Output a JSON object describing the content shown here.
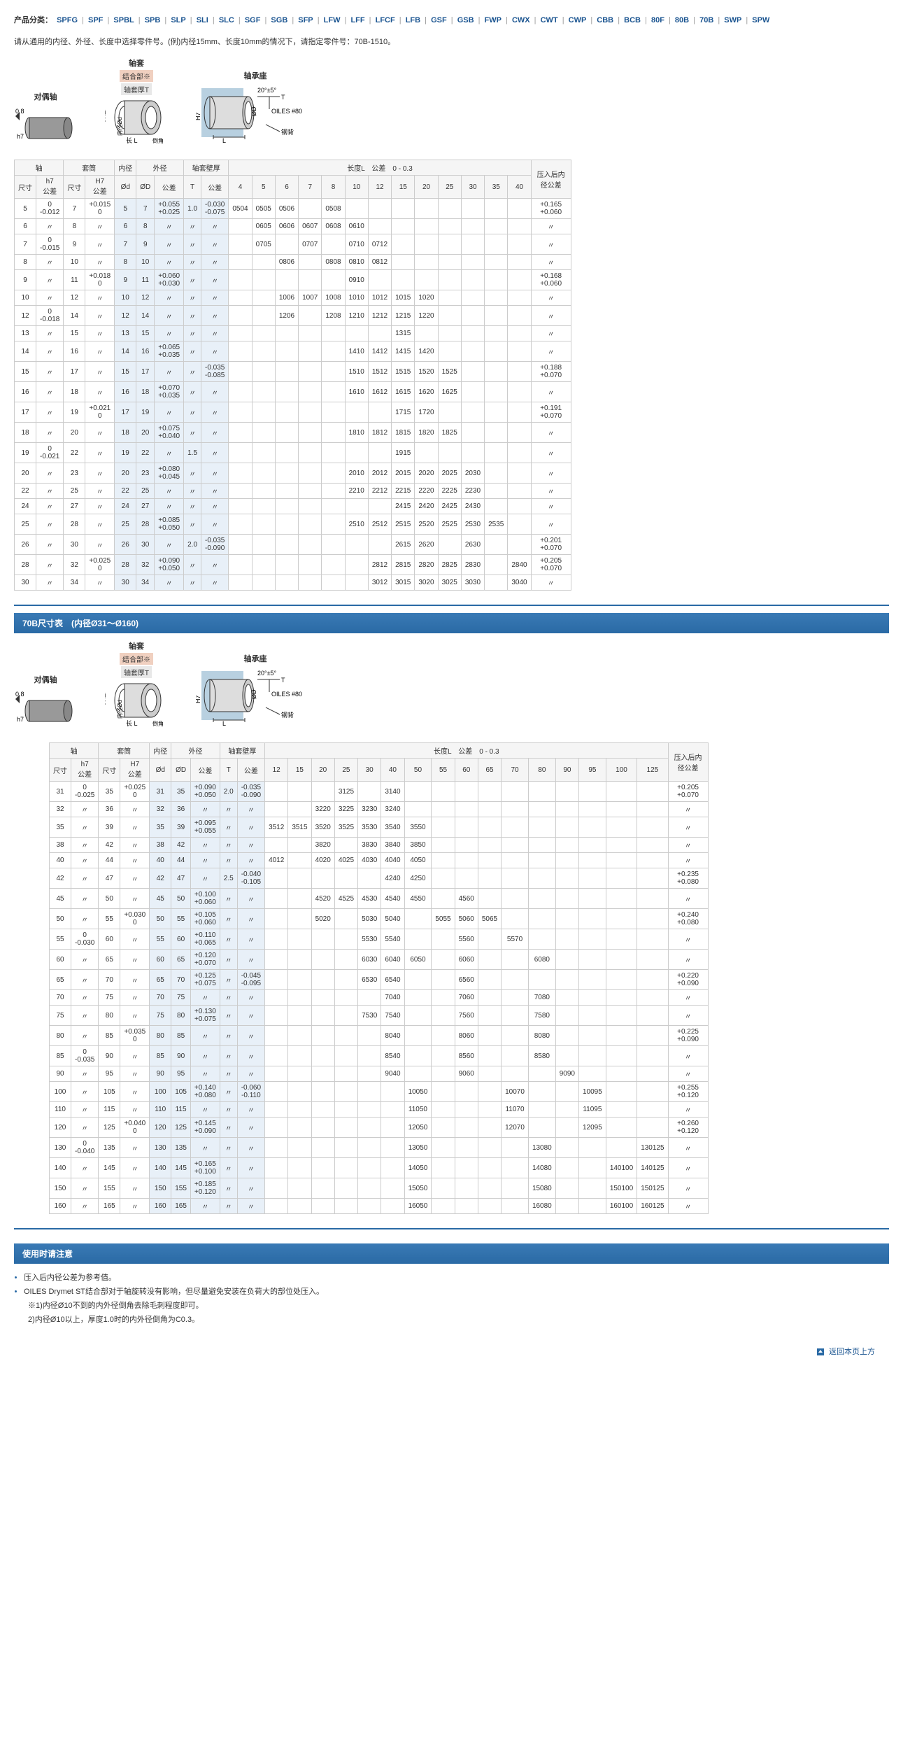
{
  "category": {
    "label": "产品分类：",
    "items": [
      "SPFG",
      "SPF",
      "SPBL",
      "SPB",
      "SLP",
      "SLI",
      "SLC",
      "SGF",
      "SGB",
      "SFP",
      "LFW",
      "LFF",
      "LFCF",
      "LFB",
      "GSF",
      "GSB",
      "FWP",
      "CWX",
      "CWT",
      "CWP",
      "CBB",
      "BCB",
      "80F",
      "80B",
      "70B",
      "SWP",
      "SPW"
    ]
  },
  "instruction": "请从通用的内径、外径、长度中选择零件号。(例)内径15mm、长度10mm的情况下，请指定零件号：70B-1510。",
  "diagrams": {
    "shaft": "对偶轴",
    "bushing": "轴套",
    "housing": "轴承座",
    "fit": "结合部※",
    "thickT": "轴套厚T",
    "oiles": "OILES #80",
    "backing": "钢背",
    "chamfer": "倒角",
    "length": "长",
    "h7": "h7",
    "H7": "H7"
  },
  "headers1": {
    "shaft": "轴",
    "housing": "套筒",
    "id": "内径",
    "od": "外径",
    "thick": "轴套壁厚",
    "length": "长度L",
    "tol": "公差",
    "tol03": "0\n- 0.3",
    "press": "压入后内径公差",
    "size": "尺寸",
    "h7": "h7\n公差",
    "H7": "H7\n公差",
    "phi_d": "Ød",
    "phi_D": "ØD",
    "T": "T"
  },
  "t1_lens": [
    "4",
    "5",
    "6",
    "7",
    "8",
    "10",
    "12",
    "15",
    "20",
    "25",
    "30",
    "35",
    "40"
  ],
  "t1": [
    {
      "d": "5",
      "h7": "0\n-0.012",
      "D": "7",
      "H7": "+0.015\n0",
      "id": "5",
      "od": "7",
      "odt": "+0.055\n+0.025",
      "T": "1.0",
      "Tt": "-0.030\n-0.075",
      "cells": [
        "0504",
        "0505",
        "0506",
        "",
        "0508",
        "",
        "",
        "",
        "",
        "",
        "",
        "",
        ""
      ],
      "p": "+0.165\n+0.060"
    },
    {
      "d": "6",
      "h7": "〃",
      "D": "8",
      "H7": "〃",
      "id": "6",
      "od": "8",
      "odt": "〃",
      "T": "〃",
      "Tt": "〃",
      "cells": [
        "",
        "0605",
        "0606",
        "0607",
        "0608",
        "0610",
        "",
        "",
        "",
        "",
        "",
        "",
        ""
      ],
      "p": "〃"
    },
    {
      "d": "7",
      "h7": "0\n-0.015",
      "D": "9",
      "H7": "〃",
      "id": "7",
      "od": "9",
      "odt": "〃",
      "T": "〃",
      "Tt": "〃",
      "cells": [
        "",
        "0705",
        "",
        "0707",
        "",
        "0710",
        "0712",
        "",
        "",
        "",
        "",
        "",
        ""
      ],
      "p": "〃"
    },
    {
      "d": "8",
      "h7": "〃",
      "D": "10",
      "H7": "〃",
      "id": "8",
      "od": "10",
      "odt": "〃",
      "T": "〃",
      "Tt": "〃",
      "cells": [
        "",
        "",
        "0806",
        "",
        "0808",
        "0810",
        "0812",
        "",
        "",
        "",
        "",
        "",
        ""
      ],
      "p": "〃"
    },
    {
      "d": "9",
      "h7": "〃",
      "D": "11",
      "H7": "+0.018\n0",
      "id": "9",
      "od": "11",
      "odt": "+0.060\n+0.030",
      "T": "〃",
      "Tt": "〃",
      "cells": [
        "",
        "",
        "",
        "",
        "",
        "0910",
        "",
        "",
        "",
        "",
        "",
        "",
        ""
      ],
      "p": "+0.168\n+0.060"
    },
    {
      "d": "10",
      "h7": "〃",
      "D": "12",
      "H7": "〃",
      "id": "10",
      "od": "12",
      "odt": "〃",
      "T": "〃",
      "Tt": "〃",
      "cells": [
        "",
        "",
        "1006",
        "1007",
        "1008",
        "1010",
        "1012",
        "1015",
        "1020",
        "",
        "",
        "",
        ""
      ],
      "p": "〃"
    },
    {
      "d": "12",
      "h7": "0\n-0.018",
      "D": "14",
      "H7": "〃",
      "id": "12",
      "od": "14",
      "odt": "〃",
      "T": "〃",
      "Tt": "〃",
      "cells": [
        "",
        "",
        "1206",
        "",
        "1208",
        "1210",
        "1212",
        "1215",
        "1220",
        "",
        "",
        "",
        ""
      ],
      "p": "〃"
    },
    {
      "d": "13",
      "h7": "〃",
      "D": "15",
      "H7": "〃",
      "id": "13",
      "od": "15",
      "odt": "〃",
      "T": "〃",
      "Tt": "〃",
      "cells": [
        "",
        "",
        "",
        "",
        "",
        "",
        "",
        "1315",
        "",
        "",
        "",
        "",
        ""
      ],
      "p": "〃"
    },
    {
      "d": "14",
      "h7": "〃",
      "D": "16",
      "H7": "〃",
      "id": "14",
      "od": "16",
      "odt": "+0.065\n+0.035",
      "T": "〃",
      "Tt": "〃",
      "cells": [
        "",
        "",
        "",
        "",
        "",
        "1410",
        "1412",
        "1415",
        "1420",
        "",
        "",
        "",
        ""
      ],
      "p": "〃"
    },
    {
      "d": "15",
      "h7": "〃",
      "D": "17",
      "H7": "〃",
      "id": "15",
      "od": "17",
      "odt": "〃",
      "T": "〃",
      "Tt": "-0.035\n-0.085",
      "cells": [
        "",
        "",
        "",
        "",
        "",
        "1510",
        "1512",
        "1515",
        "1520",
        "1525",
        "",
        "",
        ""
      ],
      "p": "+0.188\n+0.070"
    },
    {
      "d": "16",
      "h7": "〃",
      "D": "18",
      "H7": "〃",
      "id": "16",
      "od": "18",
      "odt": "+0.070\n+0.035",
      "T": "〃",
      "Tt": "〃",
      "cells": [
        "",
        "",
        "",
        "",
        "",
        "1610",
        "1612",
        "1615",
        "1620",
        "1625",
        "",
        "",
        ""
      ],
      "p": "〃"
    },
    {
      "d": "17",
      "h7": "〃",
      "D": "19",
      "H7": "+0.021\n0",
      "id": "17",
      "od": "19",
      "odt": "〃",
      "T": "〃",
      "Tt": "〃",
      "cells": [
        "",
        "",
        "",
        "",
        "",
        "",
        "",
        "1715",
        "1720",
        "",
        "",
        "",
        ""
      ],
      "p": "+0.191\n+0.070"
    },
    {
      "d": "18",
      "h7": "〃",
      "D": "20",
      "H7": "〃",
      "id": "18",
      "od": "20",
      "odt": "+0.075\n+0.040",
      "T": "〃",
      "Tt": "〃",
      "cells": [
        "",
        "",
        "",
        "",
        "",
        "1810",
        "1812",
        "1815",
        "1820",
        "1825",
        "",
        "",
        ""
      ],
      "p": "〃"
    },
    {
      "d": "19",
      "h7": "0\n-0.021",
      "D": "22",
      "H7": "〃",
      "id": "19",
      "od": "22",
      "odt": "〃",
      "T": "1.5",
      "Tt": "〃",
      "cells": [
        "",
        "",
        "",
        "",
        "",
        "",
        "",
        "1915",
        "",
        "",
        "",
        "",
        ""
      ],
      "p": "〃"
    },
    {
      "d": "20",
      "h7": "〃",
      "D": "23",
      "H7": "〃",
      "id": "20",
      "od": "23",
      "odt": "+0.080\n+0.045",
      "T": "〃",
      "Tt": "〃",
      "cells": [
        "",
        "",
        "",
        "",
        "",
        "2010",
        "2012",
        "2015",
        "2020",
        "2025",
        "2030",
        "",
        ""
      ],
      "p": "〃"
    },
    {
      "d": "22",
      "h7": "〃",
      "D": "25",
      "H7": "〃",
      "id": "22",
      "od": "25",
      "odt": "〃",
      "T": "〃",
      "Tt": "〃",
      "cells": [
        "",
        "",
        "",
        "",
        "",
        "2210",
        "2212",
        "2215",
        "2220",
        "2225",
        "2230",
        "",
        ""
      ],
      "p": "〃"
    },
    {
      "d": "24",
      "h7": "〃",
      "D": "27",
      "H7": "〃",
      "id": "24",
      "od": "27",
      "odt": "〃",
      "T": "〃",
      "Tt": "〃",
      "cells": [
        "",
        "",
        "",
        "",
        "",
        "",
        "",
        "2415",
        "2420",
        "2425",
        "2430",
        "",
        ""
      ],
      "p": "〃"
    },
    {
      "d": "25",
      "h7": "〃",
      "D": "28",
      "H7": "〃",
      "id": "25",
      "od": "28",
      "odt": "+0.085\n+0.050",
      "T": "〃",
      "Tt": "〃",
      "cells": [
        "",
        "",
        "",
        "",
        "",
        "2510",
        "2512",
        "2515",
        "2520",
        "2525",
        "2530",
        "2535",
        ""
      ],
      "p": "〃"
    },
    {
      "d": "26",
      "h7": "〃",
      "D": "30",
      "H7": "〃",
      "id": "26",
      "od": "30",
      "odt": "〃",
      "T": "2.0",
      "Tt": "-0.035\n-0.090",
      "cells": [
        "",
        "",
        "",
        "",
        "",
        "",
        "",
        "2615",
        "2620",
        "",
        "2630",
        "",
        ""
      ],
      "p": "+0.201\n+0.070"
    },
    {
      "d": "28",
      "h7": "〃",
      "D": "32",
      "H7": "+0.025\n0",
      "id": "28",
      "od": "32",
      "odt": "+0.090\n+0.050",
      "T": "〃",
      "Tt": "〃",
      "cells": [
        "",
        "",
        "",
        "",
        "",
        "",
        "2812",
        "2815",
        "2820",
        "2825",
        "2830",
        "",
        "2840"
      ],
      "p": "+0.205\n+0.070"
    },
    {
      "d": "30",
      "h7": "〃",
      "D": "34",
      "H7": "〃",
      "id": "30",
      "od": "34",
      "odt": "〃",
      "T": "〃",
      "Tt": "〃",
      "cells": [
        "",
        "",
        "",
        "",
        "",
        "",
        "3012",
        "3015",
        "3020",
        "3025",
        "3030",
        "",
        "3040"
      ],
      "p": "〃"
    }
  ],
  "section2_title": "70B尺寸表　(内径Ø31～Ø160)",
  "t2_lens": [
    "12",
    "15",
    "20",
    "25",
    "30",
    "40",
    "50",
    "55",
    "60",
    "65",
    "70",
    "80",
    "90",
    "95",
    "100",
    "125"
  ],
  "t2": [
    {
      "d": "31",
      "h7": "0\n-0.025",
      "D": "35",
      "H7": "+0.025\n0",
      "id": "31",
      "od": "35",
      "odt": "+0.090\n+0.050",
      "T": "2.0",
      "Tt": "-0.035\n-0.090",
      "cells": [
        "",
        "",
        "",
        "3125",
        "",
        "3140",
        "",
        "",
        "",
        "",
        "",
        "",
        "",
        "",
        "",
        ""
      ],
      "p": "+0.205\n+0.070"
    },
    {
      "d": "32",
      "h7": "〃",
      "D": "36",
      "H7": "〃",
      "id": "32",
      "od": "36",
      "odt": "〃",
      "T": "〃",
      "Tt": "〃",
      "cells": [
        "",
        "",
        "3220",
        "3225",
        "3230",
        "3240",
        "",
        "",
        "",
        "",
        "",
        "",
        "",
        "",
        "",
        ""
      ],
      "p": "〃"
    },
    {
      "d": "35",
      "h7": "〃",
      "D": "39",
      "H7": "〃",
      "id": "35",
      "od": "39",
      "odt": "+0.095\n+0.055",
      "T": "〃",
      "Tt": "〃",
      "cells": [
        "3512",
        "3515",
        "3520",
        "3525",
        "3530",
        "3540",
        "3550",
        "",
        "",
        "",
        "",
        "",
        "",
        "",
        "",
        ""
      ],
      "p": "〃"
    },
    {
      "d": "38",
      "h7": "〃",
      "D": "42",
      "H7": "〃",
      "id": "38",
      "od": "42",
      "odt": "〃",
      "T": "〃",
      "Tt": "〃",
      "cells": [
        "",
        "",
        "3820",
        "",
        "3830",
        "3840",
        "3850",
        "",
        "",
        "",
        "",
        "",
        "",
        "",
        "",
        ""
      ],
      "p": "〃"
    },
    {
      "d": "40",
      "h7": "〃",
      "D": "44",
      "H7": "〃",
      "id": "40",
      "od": "44",
      "odt": "〃",
      "T": "〃",
      "Tt": "〃",
      "cells": [
        "4012",
        "",
        "4020",
        "4025",
        "4030",
        "4040",
        "4050",
        "",
        "",
        "",
        "",
        "",
        "",
        "",
        "",
        ""
      ],
      "p": "〃"
    },
    {
      "d": "42",
      "h7": "〃",
      "D": "47",
      "H7": "〃",
      "id": "42",
      "od": "47",
      "odt": "〃",
      "T": "2.5",
      "Tt": "-0.040\n-0.105",
      "cells": [
        "",
        "",
        "",
        "",
        "",
        "4240",
        "4250",
        "",
        "",
        "",
        "",
        "",
        "",
        "",
        "",
        ""
      ],
      "p": "+0.235\n+0.080"
    },
    {
      "d": "45",
      "h7": "〃",
      "D": "50",
      "H7": "〃",
      "id": "45",
      "od": "50",
      "odt": "+0.100\n+0.060",
      "T": "〃",
      "Tt": "〃",
      "cells": [
        "",
        "",
        "4520",
        "4525",
        "4530",
        "4540",
        "4550",
        "",
        "4560",
        "",
        "",
        "",
        "",
        "",
        "",
        ""
      ],
      "p": "〃"
    },
    {
      "d": "50",
      "h7": "〃",
      "D": "55",
      "H7": "+0.030\n0",
      "id": "50",
      "od": "55",
      "odt": "+0.105\n+0.060",
      "T": "〃",
      "Tt": "〃",
      "cells": [
        "",
        "",
        "5020",
        "",
        "5030",
        "5040",
        "",
        "5055",
        "5060",
        "5065",
        "",
        "",
        "",
        "",
        "",
        ""
      ],
      "p": "+0.240\n+0.080"
    },
    {
      "d": "55",
      "h7": "0\n-0.030",
      "D": "60",
      "H7": "〃",
      "id": "55",
      "od": "60",
      "odt": "+0.110\n+0.065",
      "T": "〃",
      "Tt": "〃",
      "cells": [
        "",
        "",
        "",
        "",
        "5530",
        "5540",
        "",
        "",
        "5560",
        "",
        "5570",
        "",
        "",
        "",
        "",
        ""
      ],
      "p": "〃"
    },
    {
      "d": "60",
      "h7": "〃",
      "D": "65",
      "H7": "〃",
      "id": "60",
      "od": "65",
      "odt": "+0.120\n+0.070",
      "T": "〃",
      "Tt": "〃",
      "cells": [
        "",
        "",
        "",
        "",
        "6030",
        "6040",
        "6050",
        "",
        "6060",
        "",
        "",
        "6080",
        "",
        "",
        "",
        ""
      ],
      "p": "〃"
    },
    {
      "d": "65",
      "h7": "〃",
      "D": "70",
      "H7": "〃",
      "id": "65",
      "od": "70",
      "odt": "+0.125\n+0.075",
      "T": "〃",
      "Tt": "-0.045\n-0.095",
      "cells": [
        "",
        "",
        "",
        "",
        "6530",
        "6540",
        "",
        "",
        "6560",
        "",
        "",
        "",
        "",
        "",
        "",
        ""
      ],
      "p": "+0.220\n+0.090"
    },
    {
      "d": "70",
      "h7": "〃",
      "D": "75",
      "H7": "〃",
      "id": "70",
      "od": "75",
      "odt": "〃",
      "T": "〃",
      "Tt": "〃",
      "cells": [
        "",
        "",
        "",
        "",
        "",
        "7040",
        "",
        "",
        "7060",
        "",
        "",
        "7080",
        "",
        "",
        "",
        ""
      ],
      "p": "〃"
    },
    {
      "d": "75",
      "h7": "〃",
      "D": "80",
      "H7": "〃",
      "id": "75",
      "od": "80",
      "odt": "+0.130\n+0.075",
      "T": "〃",
      "Tt": "〃",
      "cells": [
        "",
        "",
        "",
        "",
        "7530",
        "7540",
        "",
        "",
        "7560",
        "",
        "",
        "7580",
        "",
        "",
        "",
        ""
      ],
      "p": "〃"
    },
    {
      "d": "80",
      "h7": "〃",
      "D": "85",
      "H7": "+0.035\n0",
      "id": "80",
      "od": "85",
      "odt": "〃",
      "T": "〃",
      "Tt": "〃",
      "cells": [
        "",
        "",
        "",
        "",
        "",
        "8040",
        "",
        "",
        "8060",
        "",
        "",
        "8080",
        "",
        "",
        "",
        ""
      ],
      "p": "+0.225\n+0.090"
    },
    {
      "d": "85",
      "h7": "0\n-0.035",
      "D": "90",
      "H7": "〃",
      "id": "85",
      "od": "90",
      "odt": "〃",
      "T": "〃",
      "Tt": "〃",
      "cells": [
        "",
        "",
        "",
        "",
        "",
        "8540",
        "",
        "",
        "8560",
        "",
        "",
        "8580",
        "",
        "",
        "",
        ""
      ],
      "p": "〃"
    },
    {
      "d": "90",
      "h7": "〃",
      "D": "95",
      "H7": "〃",
      "id": "90",
      "od": "95",
      "odt": "〃",
      "T": "〃",
      "Tt": "〃",
      "cells": [
        "",
        "",
        "",
        "",
        "",
        "9040",
        "",
        "",
        "9060",
        "",
        "",
        "",
        "9090",
        "",
        "",
        ""
      ],
      "p": "〃"
    },
    {
      "d": "100",
      "h7": "〃",
      "D": "105",
      "H7": "〃",
      "id": "100",
      "od": "105",
      "odt": "+0.140\n+0.080",
      "T": "〃",
      "Tt": "-0.060\n-0.110",
      "cells": [
        "",
        "",
        "",
        "",
        "",
        "",
        "10050",
        "",
        "",
        "",
        "10070",
        "",
        "",
        "10095",
        "",
        ""
      ],
      "p": "+0.255\n+0.120"
    },
    {
      "d": "110",
      "h7": "〃",
      "D": "115",
      "H7": "〃",
      "id": "110",
      "od": "115",
      "odt": "〃",
      "T": "〃",
      "Tt": "〃",
      "cells": [
        "",
        "",
        "",
        "",
        "",
        "",
        "11050",
        "",
        "",
        "",
        "11070",
        "",
        "",
        "11095",
        "",
        ""
      ],
      "p": "〃"
    },
    {
      "d": "120",
      "h7": "〃",
      "D": "125",
      "H7": "+0.040\n0",
      "id": "120",
      "od": "125",
      "odt": "+0.145\n+0.090",
      "T": "〃",
      "Tt": "〃",
      "cells": [
        "",
        "",
        "",
        "",
        "",
        "",
        "12050",
        "",
        "",
        "",
        "12070",
        "",
        "",
        "12095",
        "",
        ""
      ],
      "p": "+0.260\n+0.120"
    },
    {
      "d": "130",
      "h7": "0\n-0.040",
      "D": "135",
      "H7": "〃",
      "id": "130",
      "od": "135",
      "odt": "〃",
      "T": "〃",
      "Tt": "〃",
      "cells": [
        "",
        "",
        "",
        "",
        "",
        "",
        "13050",
        "",
        "",
        "",
        "",
        "13080",
        "",
        "",
        "",
        "130125"
      ],
      "p": "〃"
    },
    {
      "d": "140",
      "h7": "〃",
      "D": "145",
      "H7": "〃",
      "id": "140",
      "od": "145",
      "odt": "+0.165\n+0.100",
      "T": "〃",
      "Tt": "〃",
      "cells": [
        "",
        "",
        "",
        "",
        "",
        "",
        "14050",
        "",
        "",
        "",
        "",
        "14080",
        "",
        "",
        "140100",
        "140125"
      ],
      "p": "〃"
    },
    {
      "d": "150",
      "h7": "〃",
      "D": "155",
      "H7": "〃",
      "id": "150",
      "od": "155",
      "odt": "+0.185\n+0.120",
      "T": "〃",
      "Tt": "〃",
      "cells": [
        "",
        "",
        "",
        "",
        "",
        "",
        "15050",
        "",
        "",
        "",
        "",
        "15080",
        "",
        "",
        "150100",
        "150125"
      ],
      "p": "〃"
    },
    {
      "d": "160",
      "h7": "〃",
      "D": "165",
      "H7": "〃",
      "id": "160",
      "od": "165",
      "odt": "〃",
      "T": "〃",
      "Tt": "〃",
      "cells": [
        "",
        "",
        "",
        "",
        "",
        "",
        "16050",
        "",
        "",
        "",
        "",
        "16080",
        "",
        "",
        "160100",
        "160125"
      ],
      "p": "〃"
    }
  ],
  "notes_title": "使用时请注意",
  "notes": [
    "压入后内径公差为参考值。",
    "OILES Drymet ST结合部对于轴旋转没有影响，但尽量避免安装在负荷大的部位处压入。",
    "※1)内径Ø10不到的内外径倒角去除毛刺程度即可。",
    "2)内径Ø10以上，厚度1.0时的内外径倒角为C0.3。"
  ],
  "footer": "返回本页上方"
}
